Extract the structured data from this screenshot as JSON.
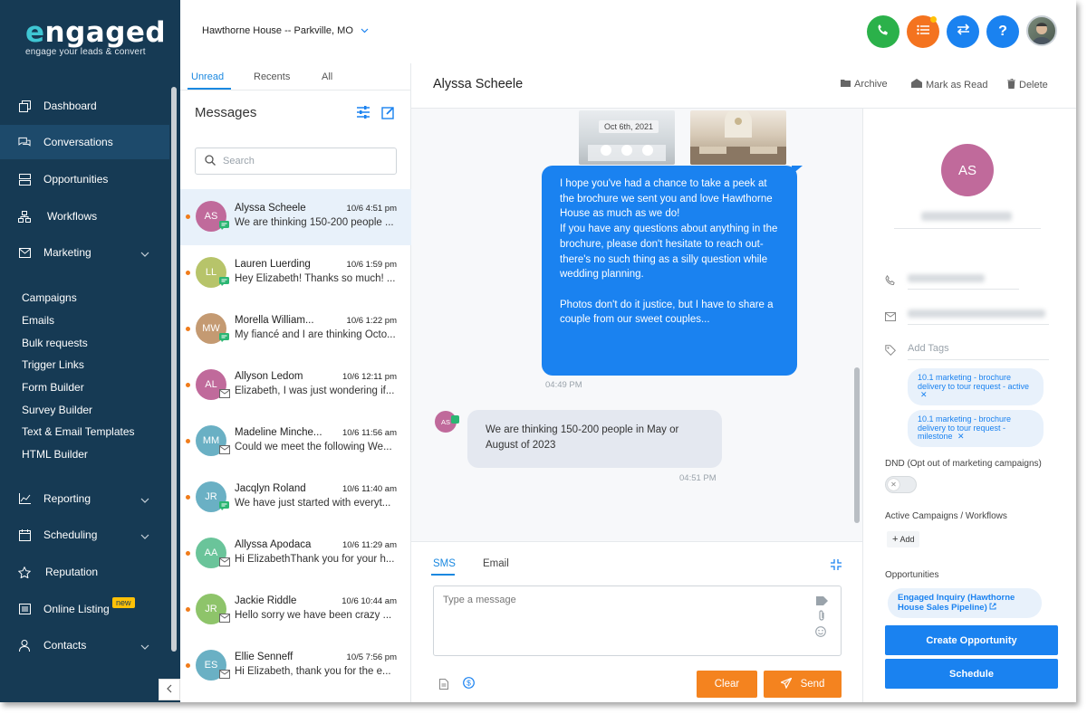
{
  "brand": {
    "logo_text": "engaged",
    "tagline": "engage your leads & convert"
  },
  "sidebar": {
    "items": [
      {
        "label": "Dashboard",
        "icon": "copy-icon"
      },
      {
        "label": "Conversations",
        "icon": "chat-icon",
        "active": true
      },
      {
        "label": "Opportunities",
        "icon": "stack-icon"
      },
      {
        "label": "Workflows",
        "icon": "workflow-icon"
      },
      {
        "label": "Marketing",
        "icon": "mail-icon",
        "expanded": true
      },
      {
        "label": "Reporting",
        "icon": "chart-icon"
      },
      {
        "label": "Scheduling",
        "icon": "calendar-icon"
      },
      {
        "label": "Reputation",
        "icon": "star-icon"
      },
      {
        "label": "Online Listing",
        "icon": "listing-icon",
        "badge": "new"
      },
      {
        "label": "Contacts",
        "icon": "person-icon"
      }
    ],
    "marketing_sub": [
      "Campaigns",
      "Emails",
      "Bulk requests",
      "Trigger Links",
      "Form Builder",
      "Survey Builder",
      "Text & Email Templates",
      "HTML Builder"
    ]
  },
  "topbar": {
    "location": "Hawthorne House -- Parkville, MO",
    "buttons": [
      {
        "name": "phone-icon",
        "color": "#2bb14a"
      },
      {
        "name": "tasks-icon",
        "color": "#f4731f"
      },
      {
        "name": "switch-icon",
        "color": "#1a82f0"
      },
      {
        "name": "help-icon",
        "color": "#1a82f0"
      }
    ]
  },
  "conv_list": {
    "tabs": [
      "Unread",
      "Recents",
      "All"
    ],
    "title": "Messages",
    "search_placeholder": "Search",
    "items": [
      {
        "initials": "AS",
        "color": "#c06a9b",
        "name": "Alyssa Scheele",
        "time": "10/6 4:51 pm",
        "preview": "We are thinking 150-200 people ...",
        "channel": "sms"
      },
      {
        "initials": "LL",
        "color": "#b7c46a",
        "name": "Lauren Luerding",
        "time": "10/6 1:59 pm",
        "preview": "Hey Elizabeth! Thanks so much! ...",
        "channel": "sms"
      },
      {
        "initials": "MW",
        "color": "#c49a72",
        "name": "Morella William...",
        "time": "10/6 1:22 pm",
        "preview": "My fiancé and I are thinking Octo...",
        "channel": "sms"
      },
      {
        "initials": "AL",
        "color": "#c06a9b",
        "name": "Allyson Ledom",
        "time": "10/6 12:11 pm",
        "preview": "Elizabeth, I was just wondering if...",
        "channel": "email"
      },
      {
        "initials": "MM",
        "color": "#6ab0c4",
        "name": "Madeline Minche...",
        "time": "10/6 11:56 am",
        "preview": "Could we meet the following We...",
        "channel": "email"
      },
      {
        "initials": "JR",
        "color": "#6ab0c4",
        "name": "Jacqlyn Roland",
        "time": "10/6 11:40 am",
        "preview": "We have just started with everyt...",
        "channel": "sms"
      },
      {
        "initials": "AA",
        "color": "#6ac49a",
        "name": "Allyssa Apodaca",
        "time": "10/6 11:29 am",
        "preview": "Hi ElizabethThank you for your h...",
        "channel": "email"
      },
      {
        "initials": "JR",
        "color": "#8ec46a",
        "name": "Jackie Riddle",
        "time": "10/6 10:44 am",
        "preview": "Hello sorry we have been crazy ...",
        "channel": "email"
      },
      {
        "initials": "ES",
        "color": "#6ab0c4",
        "name": "Ellie Senneff",
        "time": "10/5 7:56 pm",
        "preview": "Hi Elizabeth, thank you for the e...",
        "channel": "email"
      }
    ]
  },
  "chat": {
    "contact_name": "Alyssa Scheele",
    "actions": [
      "Archive",
      "Mark as Read",
      "Delete"
    ],
    "photo_date": "Oct 6th, 2021",
    "outgoing": {
      "text": "I hope you've had a chance to take a peek at the brochure we sent you and love Hawthorne House as much as we do!\nIf you have any questions about anything in the brochure, please don't hesitate to reach out- there's no such thing as a silly question while wedding planning.\n\nPhotos don't do it justice, but I have to share a couple from our sweet couples...",
      "time": "04:49 PM"
    },
    "incoming": {
      "avatar": "AS",
      "text": "We are thinking 150-200 people in May or August of 2023",
      "time": "04:51 PM"
    },
    "composer": {
      "tabs": [
        "SMS",
        "Email"
      ],
      "placeholder": "Type a message",
      "clear_label": "Clear",
      "send_label": "Send"
    }
  },
  "contact_panel": {
    "initials": "AS",
    "add_tags": "Add Tags",
    "tags": [
      "10.1 marketing - brochure delivery to tour request - active",
      "10.1 marketing - brochure delivery to tour request - milestone"
    ],
    "dnd_label": "DND (Opt out of marketing campaigns)",
    "campaigns_label": "Active Campaigns / Workflows",
    "add_label": "Add",
    "opportunities_label": "Opportunities",
    "opportunity": "Engaged Inquiry (Hawthorne House Sales Pipeline)",
    "create_label": "Create Opportunity",
    "schedule_label": "Schedule"
  }
}
